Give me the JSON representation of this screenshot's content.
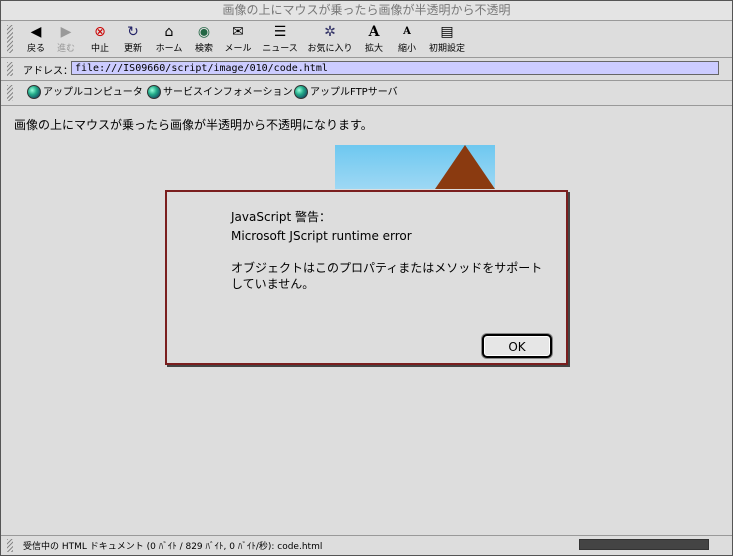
{
  "window": {
    "title": "画像の上にマウスが乗ったら画像が半透明から不透明"
  },
  "toolbar": {
    "back": "戻る",
    "forward": "進む",
    "stop": "中止",
    "refresh": "更新",
    "home": "ホーム",
    "search": "検索",
    "mail": "メール",
    "news": "ニュース",
    "favorites": "お気に入り",
    "larger": "拡大",
    "smaller": "縮小",
    "prefs": "初期設定"
  },
  "address": {
    "label": "アドレス：",
    "value": "file:///IS09660/script/image/010/code.html"
  },
  "favbar": {
    "items": [
      "アップルコンピュータ",
      "サービスインフォメーション",
      "アップルFTPサーバ"
    ]
  },
  "page": {
    "message": "画像の上にマウスが乗ったら画像が半透明から不透明になります。"
  },
  "dialog": {
    "title": "JavaScript 警告：",
    "error": "Microsoft JScript runtime error",
    "body": "オブジェクトはこのプロパティまたはメソッドをサポートしていません。",
    "ok": "OK"
  },
  "status": {
    "text": "受信中の HTML ドキュメント (0 ﾊﾞｲﾄ / 829 ﾊﾞｲﾄ, 0 ﾊﾞｲﾄ/秒): code.html"
  },
  "colors": {
    "dialog_border": "#7a1e1e",
    "address_bg": "#ccccff"
  }
}
